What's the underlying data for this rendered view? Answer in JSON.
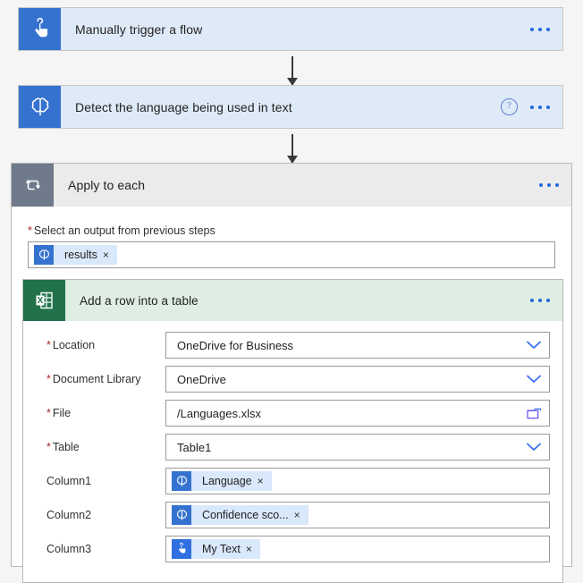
{
  "flow": {
    "trigger": {
      "title": "Manually trigger a flow",
      "icon": "hand-tap-icon",
      "menu": "more-commands"
    },
    "detect_action": {
      "title": "Detect the language being used in text",
      "icon": "cognitive-brain-icon",
      "help": "?",
      "menu": "more-commands"
    },
    "scope": {
      "title": "Apply to each",
      "icon": "loop-icon",
      "menu": "more-commands",
      "output_label": "Select an output from previous steps",
      "required_star": "*",
      "output_token": {
        "label": "results",
        "icon": "cognitive-brain-icon",
        "remove": "×"
      }
    },
    "excel_action": {
      "title": "Add a row into a table",
      "icon": "excel-icon",
      "menu": "more-commands",
      "fields": [
        {
          "label": "Location",
          "required": true,
          "type": "dropdown",
          "value": "OneDrive for Business"
        },
        {
          "label": "Document Library",
          "required": true,
          "type": "dropdown",
          "value": "OneDrive"
        },
        {
          "label": "File",
          "required": true,
          "type": "filepicker",
          "value": "/Languages.xlsx"
        },
        {
          "label": "Table",
          "required": true,
          "type": "dropdown",
          "value": "Table1"
        },
        {
          "label": "Column1",
          "required": false,
          "type": "token",
          "token_label": "Language",
          "token_icon": "cognitive-brain-icon",
          "token_remove": "×"
        },
        {
          "label": "Column2",
          "required": false,
          "type": "token",
          "token_label": "Confidence sco...",
          "token_icon": "cognitive-brain-icon",
          "token_remove": "×"
        },
        {
          "label": "Column3",
          "required": false,
          "type": "token",
          "token_label": "My Text",
          "token_icon": "hand-tap-icon",
          "token_remove": "×"
        }
      ]
    }
  },
  "colors": {
    "trigger_card_bg": "#dfeaf8",
    "trigger_icon_bg": "#3572cf",
    "scope_header_bg": "#ebebeb",
    "scope_icon_bg": "#6f7a8b",
    "excel_header_bg": "#dfeee3",
    "excel_icon_bg": "#21724a",
    "accent_blue": "#2266dd",
    "required_red": "#a4262c",
    "page_bg": "#f5f5f5"
  }
}
